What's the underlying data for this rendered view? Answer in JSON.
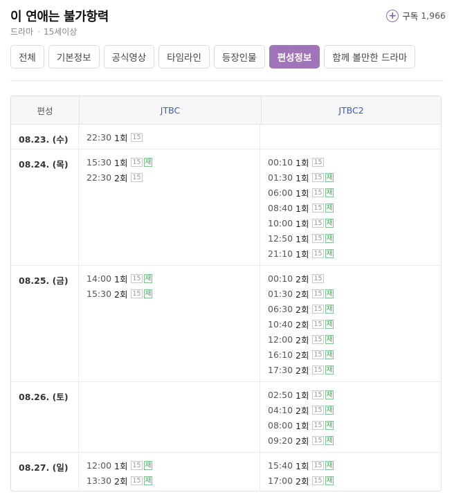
{
  "header": {
    "title": "이 연애는 불가항력",
    "genre": "드라마",
    "separator": "·",
    "rating": "15세이상",
    "subscribe_label": "구독",
    "subscribe_count": "1,966"
  },
  "tabs": [
    {
      "label": "전체",
      "active": false
    },
    {
      "label": "기본정보",
      "active": false
    },
    {
      "label": "공식영상",
      "active": false
    },
    {
      "label": "타임라인",
      "active": false
    },
    {
      "label": "등장인물",
      "active": false
    },
    {
      "label": "편성정보",
      "active": true
    },
    {
      "label": "함께 볼만한 드라마",
      "active": false
    }
  ],
  "schedule": {
    "headers": {
      "date": "편성",
      "ch1": "JTBC",
      "ch2": "JTBC2"
    },
    "rows": [
      {
        "date": "08.23. (수)",
        "jtbc": [
          {
            "time": "22:30",
            "ep": "1회",
            "badges": [
              "15"
            ]
          }
        ],
        "jtbc2": []
      },
      {
        "date": "08.24. (목)",
        "jtbc": [
          {
            "time": "15:30",
            "ep": "1회",
            "badges": [
              "15",
              "재"
            ]
          },
          {
            "time": "22:30",
            "ep": "2회",
            "badges": [
              "15"
            ]
          }
        ],
        "jtbc2": [
          {
            "time": "00:10",
            "ep": "1회",
            "badges": [
              "15"
            ]
          },
          {
            "time": "01:30",
            "ep": "1회",
            "badges": [
              "15",
              "재"
            ]
          },
          {
            "time": "06:00",
            "ep": "1회",
            "badges": [
              "15",
              "재"
            ]
          },
          {
            "time": "08:40",
            "ep": "1회",
            "badges": [
              "15",
              "재"
            ]
          },
          {
            "time": "10:00",
            "ep": "1회",
            "badges": [
              "15",
              "재"
            ]
          },
          {
            "time": "12:50",
            "ep": "1회",
            "badges": [
              "15",
              "재"
            ]
          },
          {
            "time": "21:10",
            "ep": "1회",
            "badges": [
              "15",
              "재"
            ]
          }
        ]
      },
      {
        "date": "08.25. (금)",
        "jtbc": [
          {
            "time": "14:00",
            "ep": "1회",
            "badges": [
              "15",
              "재"
            ]
          },
          {
            "time": "15:30",
            "ep": "2회",
            "badges": [
              "15",
              "재"
            ]
          }
        ],
        "jtbc2": [
          {
            "time": "00:10",
            "ep": "2회",
            "badges": [
              "15"
            ]
          },
          {
            "time": "01:30",
            "ep": "2회",
            "badges": [
              "15",
              "재"
            ]
          },
          {
            "time": "06:30",
            "ep": "2회",
            "badges": [
              "15",
              "재"
            ]
          },
          {
            "time": "10:40",
            "ep": "2회",
            "badges": [
              "15",
              "재"
            ]
          },
          {
            "time": "12:00",
            "ep": "2회",
            "badges": [
              "15",
              "재"
            ]
          },
          {
            "time": "16:10",
            "ep": "2회",
            "badges": [
              "15",
              "재"
            ]
          },
          {
            "time": "17:30",
            "ep": "2회",
            "badges": [
              "15",
              "재"
            ]
          }
        ]
      },
      {
        "date": "08.26. (토)",
        "jtbc": [],
        "jtbc2": [
          {
            "time": "02:50",
            "ep": "1회",
            "badges": [
              "15",
              "재"
            ]
          },
          {
            "time": "04:10",
            "ep": "2회",
            "badges": [
              "15",
              "재"
            ]
          },
          {
            "time": "08:00",
            "ep": "1회",
            "badges": [
              "15",
              "재"
            ]
          },
          {
            "time": "09:20",
            "ep": "2회",
            "badges": [
              "15",
              "재"
            ]
          }
        ]
      },
      {
        "date": "08.27. (일)",
        "jtbc": [
          {
            "time": "12:00",
            "ep": "1회",
            "badges": [
              "15",
              "재"
            ]
          },
          {
            "time": "13:30",
            "ep": "2회",
            "badges": [
              "15",
              "재"
            ]
          }
        ],
        "jtbc2": [
          {
            "time": "15:40",
            "ep": "1회",
            "badges": [
              "15",
              "재"
            ]
          },
          {
            "time": "17:00",
            "ep": "2회",
            "badges": [
              "15",
              "재"
            ]
          }
        ]
      }
    ]
  },
  "colors": {
    "accent": "#a074b8",
    "channel": "#3b5bb5",
    "rerun_badge": "#3f9a52"
  }
}
